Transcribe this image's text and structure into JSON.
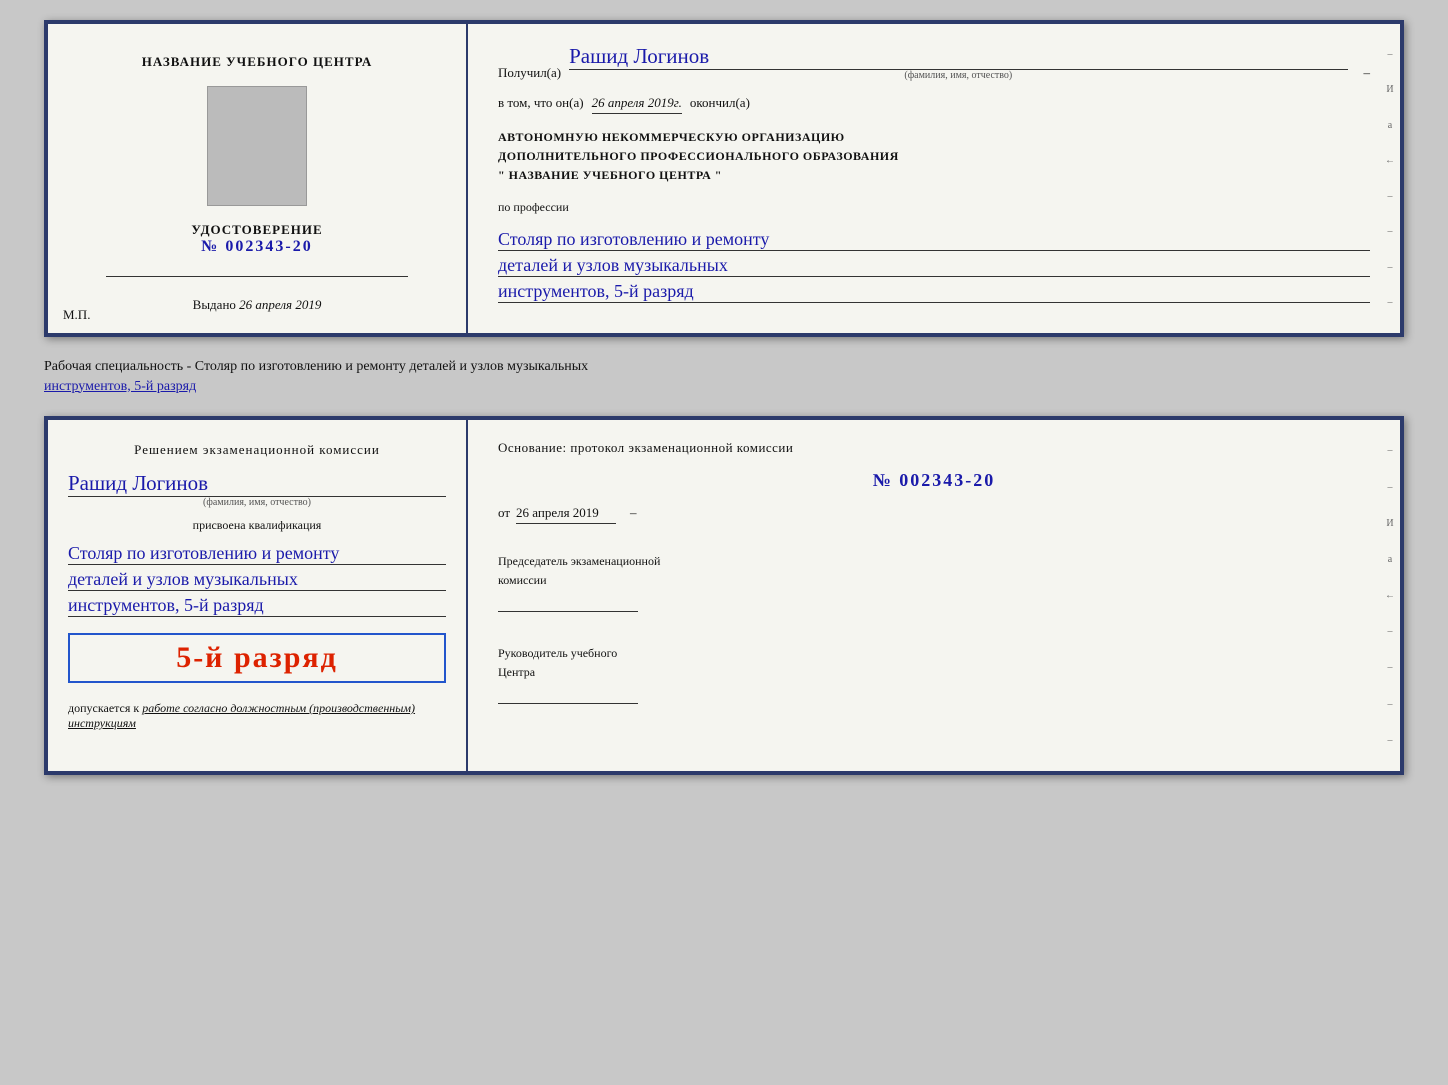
{
  "top_cert": {
    "left": {
      "title": "НАЗВАНИЕ УЧЕБНОГО ЦЕНТРА",
      "cert_label": "УДОСТОВЕРЕНИЕ",
      "cert_number_prefix": "№",
      "cert_number": "002343-20",
      "issued_label": "Выдано",
      "issued_date": "26 апреля 2019",
      "mp_label": "М.П."
    },
    "right": {
      "received_label": "Получил(а)",
      "recipient_name": "Рашид Логинов",
      "fio_subtitle": "(фамилия, имя, отчество)",
      "confirmed_label": "в том, что он(а)",
      "confirmed_date": "26 апреля 2019г.",
      "finished_label": "окончил(а)",
      "org_line1": "АВТОНОМНУЮ НЕКОММЕРЧЕСКУЮ ОРГАНИЗАЦИЮ",
      "org_line2": "ДОПОЛНИТЕЛЬНОГО ПРОФЕССИОНАЛЬНОГО ОБРАЗОВАНИЯ",
      "org_line3": "\"   НАЗВАНИЕ УЧЕБНОГО ЦЕНТРА   \"",
      "profession_label": "по профессии",
      "profession_line1": "Столяр по изготовлению и ремонту",
      "profession_line2": "деталей и узлов музыкальных",
      "profession_line3": "инструментов, 5-й разряд"
    }
  },
  "between": {
    "text": "Рабочая специальность - Столяр по изготовлению и ремонту деталей и узлов музыкальных",
    "text2": "инструментов, 5-й разряд"
  },
  "bottom_cert": {
    "left": {
      "commission_title": "Решением экзаменационной комиссии",
      "recipient_name": "Рашид Логинов",
      "fio_subtitle": "(фамилия, имя, отчество)",
      "assigned_label": "присвоена квалификация",
      "qualification_line1": "Столяр по изготовлению и ремонту",
      "qualification_line2": "деталей и узлов музыкальных",
      "qualification_line3": "инструментов, 5-й разряд",
      "rank_highlighted": "5-й разряд",
      "allowed_label": "допускается к",
      "allowed_italic": "работе согласно должностным (производственным) инструкциям"
    },
    "right": {
      "basis_label": "Основание: протокол экзаменационной комиссии",
      "protocol_prefix": "№",
      "protocol_number": "002343-20",
      "from_label": "от",
      "from_date": "26 апреля 2019",
      "chairman_label1": "Председатель экзаменационной",
      "chairman_label2": "комиссии",
      "director_label1": "Руководитель учебного",
      "director_label2": "Центра"
    }
  },
  "sidebar_chars": [
    "И",
    "а",
    "←",
    "–",
    "–",
    "–",
    "–",
    "–"
  ]
}
